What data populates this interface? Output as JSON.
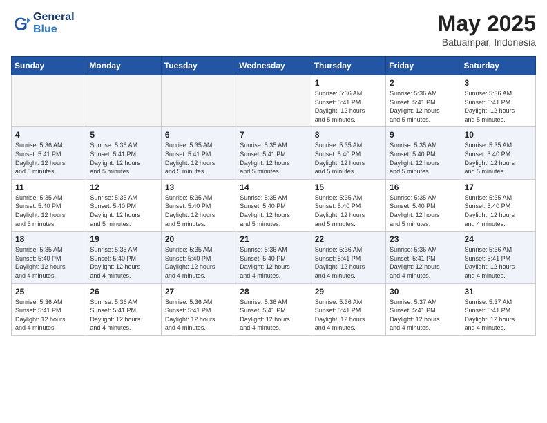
{
  "header": {
    "logo_line1": "General",
    "logo_line2": "Blue",
    "month": "May 2025",
    "location": "Batuampar, Indonesia"
  },
  "weekdays": [
    "Sunday",
    "Monday",
    "Tuesday",
    "Wednesday",
    "Thursday",
    "Friday",
    "Saturday"
  ],
  "weeks": [
    [
      {
        "day": "",
        "info": ""
      },
      {
        "day": "",
        "info": ""
      },
      {
        "day": "",
        "info": ""
      },
      {
        "day": "",
        "info": ""
      },
      {
        "day": "1",
        "info": "Sunrise: 5:36 AM\nSunset: 5:41 PM\nDaylight: 12 hours\nand 5 minutes."
      },
      {
        "day": "2",
        "info": "Sunrise: 5:36 AM\nSunset: 5:41 PM\nDaylight: 12 hours\nand 5 minutes."
      },
      {
        "day": "3",
        "info": "Sunrise: 5:36 AM\nSunset: 5:41 PM\nDaylight: 12 hours\nand 5 minutes."
      }
    ],
    [
      {
        "day": "4",
        "info": "Sunrise: 5:36 AM\nSunset: 5:41 PM\nDaylight: 12 hours\nand 5 minutes."
      },
      {
        "day": "5",
        "info": "Sunrise: 5:36 AM\nSunset: 5:41 PM\nDaylight: 12 hours\nand 5 minutes."
      },
      {
        "day": "6",
        "info": "Sunrise: 5:35 AM\nSunset: 5:41 PM\nDaylight: 12 hours\nand 5 minutes."
      },
      {
        "day": "7",
        "info": "Sunrise: 5:35 AM\nSunset: 5:41 PM\nDaylight: 12 hours\nand 5 minutes."
      },
      {
        "day": "8",
        "info": "Sunrise: 5:35 AM\nSunset: 5:40 PM\nDaylight: 12 hours\nand 5 minutes."
      },
      {
        "day": "9",
        "info": "Sunrise: 5:35 AM\nSunset: 5:40 PM\nDaylight: 12 hours\nand 5 minutes."
      },
      {
        "day": "10",
        "info": "Sunrise: 5:35 AM\nSunset: 5:40 PM\nDaylight: 12 hours\nand 5 minutes."
      }
    ],
    [
      {
        "day": "11",
        "info": "Sunrise: 5:35 AM\nSunset: 5:40 PM\nDaylight: 12 hours\nand 5 minutes."
      },
      {
        "day": "12",
        "info": "Sunrise: 5:35 AM\nSunset: 5:40 PM\nDaylight: 12 hours\nand 5 minutes."
      },
      {
        "day": "13",
        "info": "Sunrise: 5:35 AM\nSunset: 5:40 PM\nDaylight: 12 hours\nand 5 minutes."
      },
      {
        "day": "14",
        "info": "Sunrise: 5:35 AM\nSunset: 5:40 PM\nDaylight: 12 hours\nand 5 minutes."
      },
      {
        "day": "15",
        "info": "Sunrise: 5:35 AM\nSunset: 5:40 PM\nDaylight: 12 hours\nand 5 minutes."
      },
      {
        "day": "16",
        "info": "Sunrise: 5:35 AM\nSunset: 5:40 PM\nDaylight: 12 hours\nand 5 minutes."
      },
      {
        "day": "17",
        "info": "Sunrise: 5:35 AM\nSunset: 5:40 PM\nDaylight: 12 hours\nand 4 minutes."
      }
    ],
    [
      {
        "day": "18",
        "info": "Sunrise: 5:35 AM\nSunset: 5:40 PM\nDaylight: 12 hours\nand 4 minutes."
      },
      {
        "day": "19",
        "info": "Sunrise: 5:35 AM\nSunset: 5:40 PM\nDaylight: 12 hours\nand 4 minutes."
      },
      {
        "day": "20",
        "info": "Sunrise: 5:35 AM\nSunset: 5:40 PM\nDaylight: 12 hours\nand 4 minutes."
      },
      {
        "day": "21",
        "info": "Sunrise: 5:36 AM\nSunset: 5:40 PM\nDaylight: 12 hours\nand 4 minutes."
      },
      {
        "day": "22",
        "info": "Sunrise: 5:36 AM\nSunset: 5:41 PM\nDaylight: 12 hours\nand 4 minutes."
      },
      {
        "day": "23",
        "info": "Sunrise: 5:36 AM\nSunset: 5:41 PM\nDaylight: 12 hours\nand 4 minutes."
      },
      {
        "day": "24",
        "info": "Sunrise: 5:36 AM\nSunset: 5:41 PM\nDaylight: 12 hours\nand 4 minutes."
      }
    ],
    [
      {
        "day": "25",
        "info": "Sunrise: 5:36 AM\nSunset: 5:41 PM\nDaylight: 12 hours\nand 4 minutes."
      },
      {
        "day": "26",
        "info": "Sunrise: 5:36 AM\nSunset: 5:41 PM\nDaylight: 12 hours\nand 4 minutes."
      },
      {
        "day": "27",
        "info": "Sunrise: 5:36 AM\nSunset: 5:41 PM\nDaylight: 12 hours\nand 4 minutes."
      },
      {
        "day": "28",
        "info": "Sunrise: 5:36 AM\nSunset: 5:41 PM\nDaylight: 12 hours\nand 4 minutes."
      },
      {
        "day": "29",
        "info": "Sunrise: 5:36 AM\nSunset: 5:41 PM\nDaylight: 12 hours\nand 4 minutes."
      },
      {
        "day": "30",
        "info": "Sunrise: 5:37 AM\nSunset: 5:41 PM\nDaylight: 12 hours\nand 4 minutes."
      },
      {
        "day": "31",
        "info": "Sunrise: 5:37 AM\nSunset: 5:41 PM\nDaylight: 12 hours\nand 4 minutes."
      }
    ]
  ]
}
